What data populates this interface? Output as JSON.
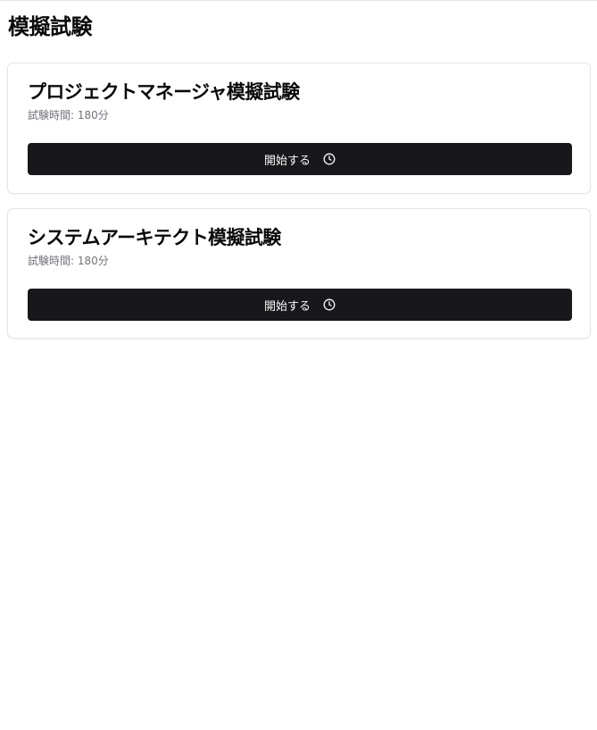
{
  "page": {
    "title": "模擬試験"
  },
  "exams": [
    {
      "title": "プロジェクトマネージャ模擬試験",
      "duration_text": "試験時間: 180分",
      "start_label": "開始する",
      "icon": "clock-icon"
    },
    {
      "title": "システムアーキテクト模擬試験",
      "duration_text": "試験時間: 180分",
      "start_label": "開始する",
      "icon": "clock-icon"
    }
  ],
  "colors": {
    "button_bg": "#18181b",
    "button_text": "#fafafa",
    "muted_text": "#71717a",
    "card_border": "#e4e4e7"
  }
}
